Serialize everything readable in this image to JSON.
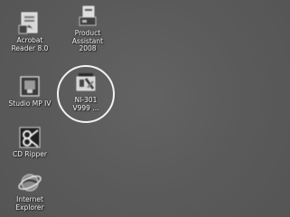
{
  "desktop": {
    "background_color": "#5b5b5b",
    "icons": [
      {
        "id": "acrobat-reader",
        "label": "Acrobat\nReader 8.0",
        "icon": "acrobat-reader-icon"
      },
      {
        "id": "studio-mp",
        "label": "Studio MP IV",
        "icon": "studio-mp-icon"
      },
      {
        "id": "cd-ripper",
        "label": "CD Ripper",
        "icon": "cd-ripper-icon"
      },
      {
        "id": "internet-explorer",
        "label": "Internet\nExplorer",
        "icon": "internet-explorer-icon"
      },
      {
        "id": "product-assistant",
        "label": "Product\nAssistant\n2008",
        "icon": "product-assistant-icon"
      },
      {
        "id": "selected-app",
        "label": "NI-301\nV999 ...",
        "icon": "setup-package-icon",
        "selected": true
      }
    ]
  }
}
